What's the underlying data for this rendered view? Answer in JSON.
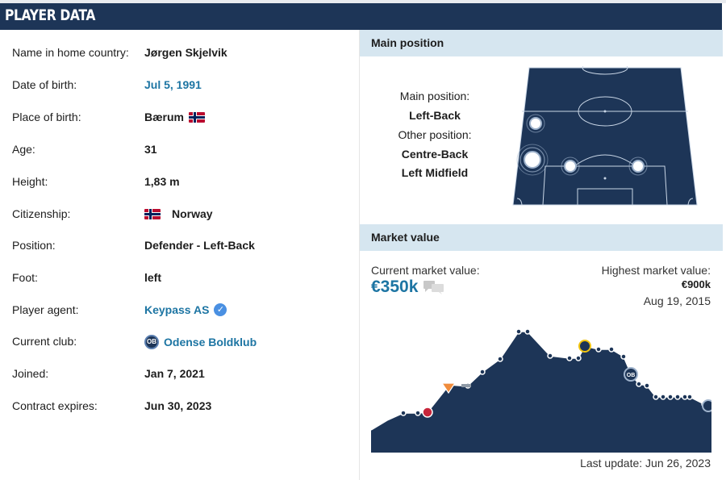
{
  "header": {
    "title": "PLAYER DATA"
  },
  "player": {
    "rows": [
      {
        "label": "Name in home country:",
        "value": "Jørgen Skjelvik",
        "style": "plain"
      },
      {
        "label": "Date of birth:",
        "value": "Jul 5, 1991",
        "style": "link"
      },
      {
        "label": "Place of birth:",
        "value": "Bærum",
        "style": "flag"
      },
      {
        "label": "Age:",
        "value": "31",
        "style": "plain"
      },
      {
        "label": "Height:",
        "value": "1,83 m",
        "style": "plain"
      },
      {
        "label": "Citizenship:",
        "value": "Norway",
        "style": "flag-before"
      },
      {
        "label": "Position:",
        "value": "Defender - Left-Back",
        "style": "plain"
      },
      {
        "label": "Foot:",
        "value": "left",
        "style": "plain"
      },
      {
        "label": "Player agent:",
        "value": "Keypass AS",
        "style": "agent"
      },
      {
        "label": "Current club:",
        "value": "Odense Boldklub",
        "style": "club"
      },
      {
        "label": "Joined:",
        "value": "Jan 7, 2021",
        "style": "plain"
      },
      {
        "label": "Contract expires:",
        "value": "Jun 30, 2023",
        "style": "plain"
      }
    ],
    "club_badge_text": "OB",
    "verified_icon": "checkmark-badge-icon",
    "flag_icon": "norway-flag-icon"
  },
  "main_position": {
    "section_title": "Main position",
    "main_label": "Main position:",
    "main_value": "Left-Back",
    "other_label": "Other position:",
    "other_values": [
      "Centre-Back",
      "Left Midfield"
    ]
  },
  "market_value": {
    "section_title": "Market value",
    "current_label": "Current market value:",
    "current_value": "€350k",
    "highest_label": "Highest market value:",
    "highest_value": "€900k",
    "highest_date": "Aug 19, 2015",
    "last_update": "Last update: Jun 26, 2023",
    "chart_fill_color": "#1d3557",
    "accent_color": "#1d75a3"
  }
}
